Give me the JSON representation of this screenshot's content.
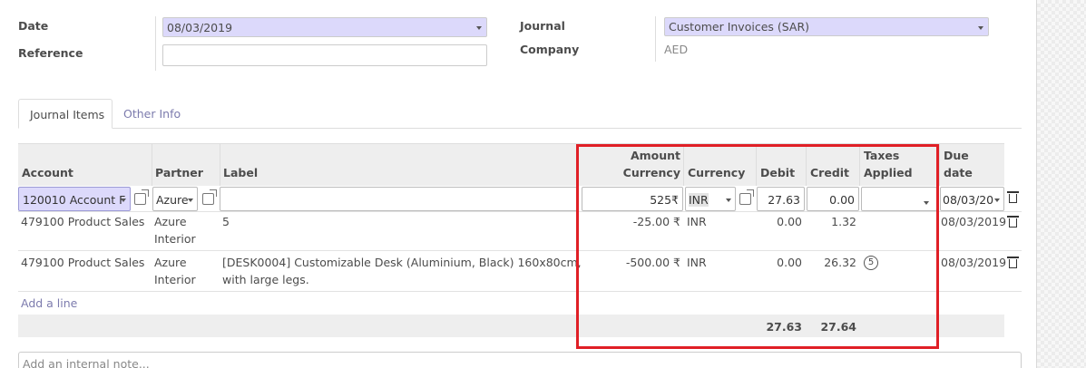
{
  "header": {
    "date_label": "Date",
    "date_value": "08/03/2019",
    "reference_label": "Reference",
    "reference_value": "",
    "journal_label": "Journal",
    "journal_value": "Customer Invoices (SAR)",
    "company_label": "Company",
    "company_value": "AED"
  },
  "tabs": [
    {
      "label": "Journal Items",
      "active": true
    },
    {
      "label": "Other Info",
      "active": false
    }
  ],
  "table": {
    "columns": {
      "account": "Account",
      "partner": "Partner",
      "label": "Label",
      "amount_currency_1": "Amount",
      "amount_currency_2": "Currency",
      "currency": "Currency",
      "debit": "Debit",
      "credit": "Credit",
      "taxes_1": "Taxes",
      "taxes_2": "Applied",
      "due_1": "Due",
      "due_2": "date"
    },
    "edit_row": {
      "account": "120010 Account F",
      "partner": "Azure",
      "label": "",
      "amount_currency": "525₹",
      "currency": "INR",
      "debit": "27.63",
      "credit": "0.00",
      "taxes": "",
      "due_date": "08/03/20"
    },
    "rows": [
      {
        "account": "479100 Product Sales",
        "partner_1": "Azure",
        "partner_2": "Interior",
        "label_1": "5",
        "label_2": "",
        "amount_currency": "-25.00 ₹",
        "currency": "INR",
        "debit": "0.00",
        "credit": "1.32",
        "taxes": "",
        "due_date": "08/03/2019"
      },
      {
        "account": "479100 Product Sales",
        "partner_1": "Azure",
        "partner_2": "Interior",
        "label_1": "[DESK0004] Customizable Desk (Aluminium, Black) 160x80cm,",
        "label_2": "with large legs.",
        "amount_currency": "-500.00 ₹",
        "currency": "INR",
        "debit": "0.00",
        "credit": "26.32",
        "taxes": "5",
        "due_date": "08/03/2019"
      }
    ],
    "add_line": "Add a line",
    "totals": {
      "debit": "27.63",
      "credit": "27.64"
    }
  },
  "note_placeholder": "Add an internal note...",
  "colors": {
    "highlight_box": "#e01f26",
    "selected_field": "#dcd9fb",
    "link": "#7c7bad"
  }
}
